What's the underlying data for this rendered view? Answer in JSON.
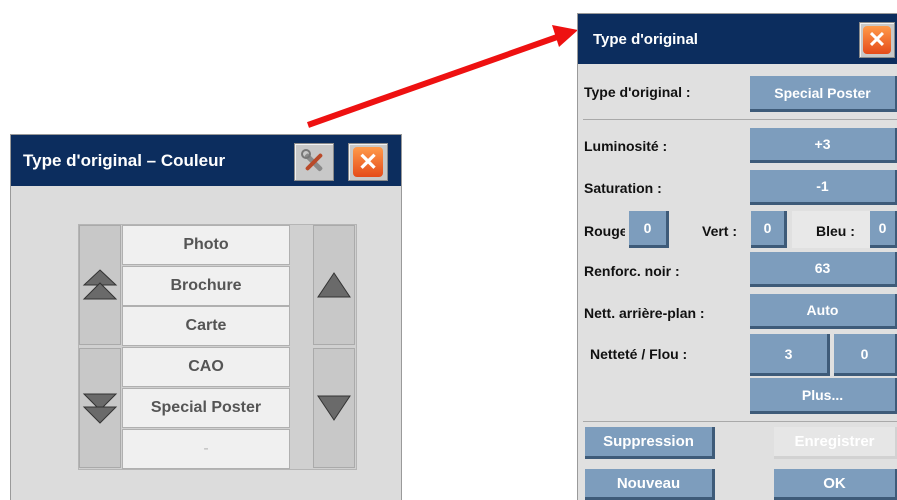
{
  "left_dialog": {
    "title": "Type d'original – Couleur",
    "tools_icon": "tools-icon",
    "close_icon": "close-icon",
    "list_items": [
      "Photo",
      "Brochure",
      "Carte",
      "CAO",
      "Special Poster",
      "-"
    ],
    "selected_item": "Special Poster"
  },
  "right_dialog": {
    "title": "Type d'original",
    "close_icon": "close-icon",
    "type_label": "Type d'original :",
    "type_value": "Special Poster",
    "luminosite_label": "Luminosité :",
    "luminosite_value": "+3",
    "saturation_label": "Saturation :",
    "saturation_value": "-1",
    "rouge_label": "Rouge",
    "rouge_value": "0",
    "vert_label": "Vert :",
    "vert_value": "0",
    "bleu_label": "Bleu :",
    "bleu_value": "0",
    "renforc_label": "Renforc. noir :",
    "renforc_value": "63",
    "nett_label": "Nett. arrière-plan :",
    "nett_value": "Auto",
    "nettete_label": "Netteté / Flou :",
    "nettete_value": "3",
    "flou_value": "0",
    "plus_label": "Plus...",
    "suppression_label": "Suppression",
    "enregistrer_label": "Enregistrer",
    "nouveau_label": "Nouveau",
    "ok_label": "OK"
  },
  "colors": {
    "titlebar": "#0c2d5e",
    "button_blue": "#7d9dbd",
    "arrow_red": "#ee0000"
  }
}
